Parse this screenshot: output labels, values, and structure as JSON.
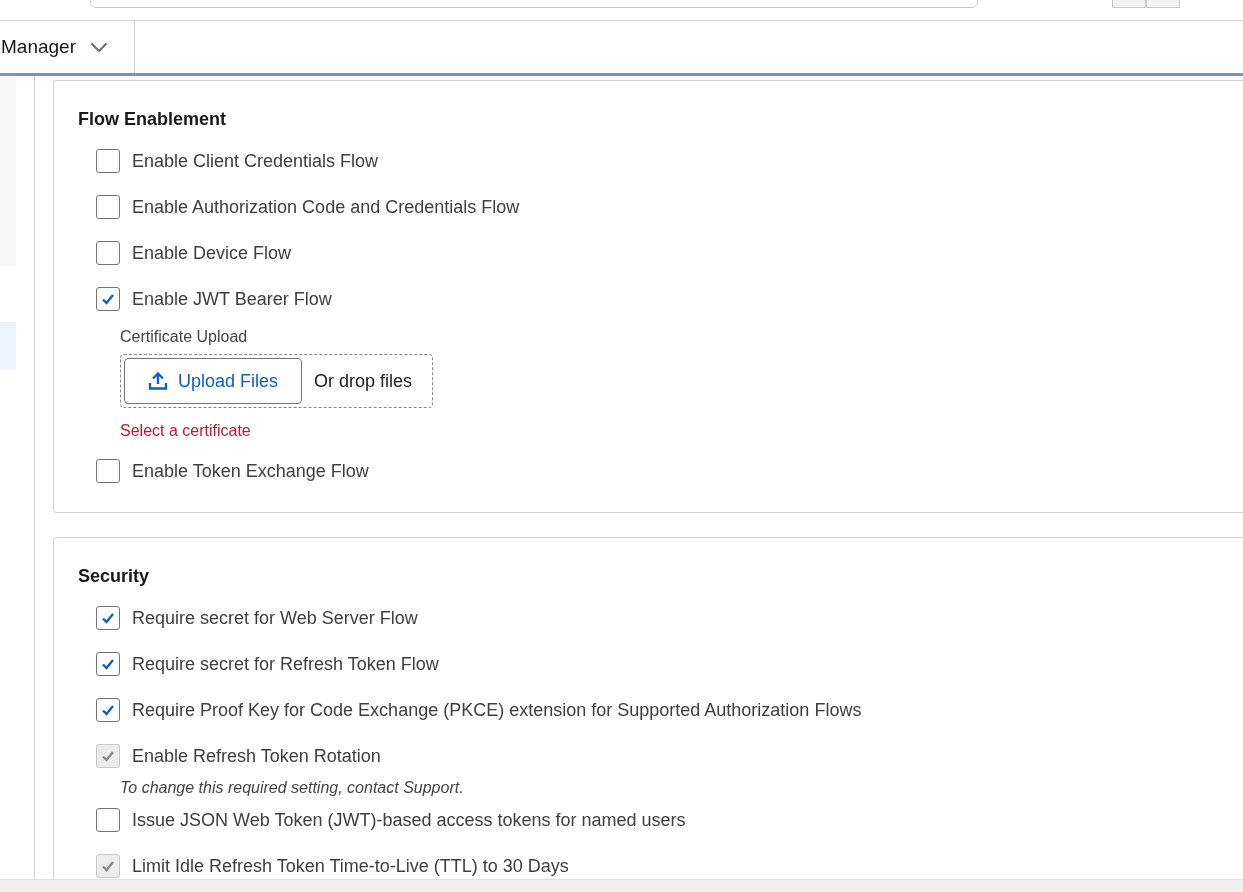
{
  "nav": {
    "tab_label": "Manager"
  },
  "sections": [
    {
      "title": "Flow Enablement",
      "items": [
        {
          "label": "Enable Client Credentials Flow",
          "checked": false,
          "disabled": false
        },
        {
          "label": "Enable Authorization Code and Credentials Flow",
          "checked": false,
          "disabled": false
        },
        {
          "label": "Enable Device Flow",
          "checked": false,
          "disabled": false
        },
        {
          "label": "Enable JWT Bearer Flow",
          "checked": true,
          "disabled": false,
          "upload": {
            "label": "Certificate Upload",
            "button": "Upload Files",
            "drop_text": "Or drop files",
            "error": "Select a certificate"
          }
        },
        {
          "label": "Enable Token Exchange Flow",
          "checked": false,
          "disabled": false
        }
      ]
    },
    {
      "title": "Security",
      "items": [
        {
          "label": "Require secret for Web Server Flow",
          "checked": true,
          "disabled": false
        },
        {
          "label": "Require secret for Refresh Token Flow",
          "checked": true,
          "disabled": false
        },
        {
          "label": "Require Proof Key for Code Exchange (PKCE) extension for Supported Authorization Flows",
          "checked": true,
          "disabled": false
        },
        {
          "label": "Enable Refresh Token Rotation",
          "checked": true,
          "disabled": true,
          "note": "To change this required setting, contact Support."
        },
        {
          "label": "Issue JSON Web Token (JWT)-based access tokens for named users",
          "checked": false,
          "disabled": false
        },
        {
          "label": "Limit Idle Refresh Token Time-to-Live (TTL) to 30 Days",
          "checked": true,
          "disabled": true
        }
      ]
    }
  ]
}
